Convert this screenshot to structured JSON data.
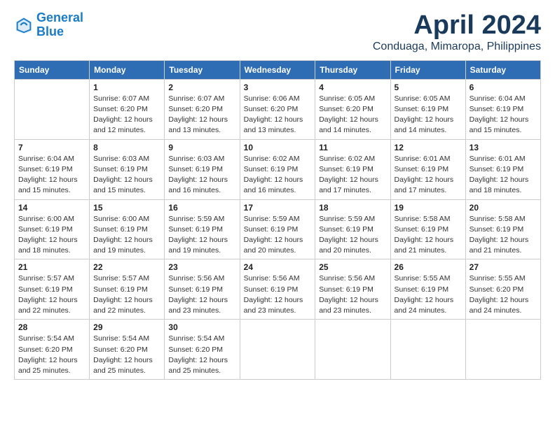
{
  "logo": {
    "line1": "General",
    "line2": "Blue"
  },
  "title": "April 2024",
  "location": "Conduaga, Mimaropa, Philippines",
  "headers": [
    "Sunday",
    "Monday",
    "Tuesday",
    "Wednesday",
    "Thursday",
    "Friday",
    "Saturday"
  ],
  "weeks": [
    [
      {
        "num": "",
        "info": ""
      },
      {
        "num": "1",
        "info": "Sunrise: 6:07 AM\nSunset: 6:20 PM\nDaylight: 12 hours\nand 12 minutes."
      },
      {
        "num": "2",
        "info": "Sunrise: 6:07 AM\nSunset: 6:20 PM\nDaylight: 12 hours\nand 13 minutes."
      },
      {
        "num": "3",
        "info": "Sunrise: 6:06 AM\nSunset: 6:20 PM\nDaylight: 12 hours\nand 13 minutes."
      },
      {
        "num": "4",
        "info": "Sunrise: 6:05 AM\nSunset: 6:20 PM\nDaylight: 12 hours\nand 14 minutes."
      },
      {
        "num": "5",
        "info": "Sunrise: 6:05 AM\nSunset: 6:19 PM\nDaylight: 12 hours\nand 14 minutes."
      },
      {
        "num": "6",
        "info": "Sunrise: 6:04 AM\nSunset: 6:19 PM\nDaylight: 12 hours\nand 15 minutes."
      }
    ],
    [
      {
        "num": "7",
        "info": "Sunrise: 6:04 AM\nSunset: 6:19 PM\nDaylight: 12 hours\nand 15 minutes."
      },
      {
        "num": "8",
        "info": "Sunrise: 6:03 AM\nSunset: 6:19 PM\nDaylight: 12 hours\nand 15 minutes."
      },
      {
        "num": "9",
        "info": "Sunrise: 6:03 AM\nSunset: 6:19 PM\nDaylight: 12 hours\nand 16 minutes."
      },
      {
        "num": "10",
        "info": "Sunrise: 6:02 AM\nSunset: 6:19 PM\nDaylight: 12 hours\nand 16 minutes."
      },
      {
        "num": "11",
        "info": "Sunrise: 6:02 AM\nSunset: 6:19 PM\nDaylight: 12 hours\nand 17 minutes."
      },
      {
        "num": "12",
        "info": "Sunrise: 6:01 AM\nSunset: 6:19 PM\nDaylight: 12 hours\nand 17 minutes."
      },
      {
        "num": "13",
        "info": "Sunrise: 6:01 AM\nSunset: 6:19 PM\nDaylight: 12 hours\nand 18 minutes."
      }
    ],
    [
      {
        "num": "14",
        "info": "Sunrise: 6:00 AM\nSunset: 6:19 PM\nDaylight: 12 hours\nand 18 minutes."
      },
      {
        "num": "15",
        "info": "Sunrise: 6:00 AM\nSunset: 6:19 PM\nDaylight: 12 hours\nand 19 minutes."
      },
      {
        "num": "16",
        "info": "Sunrise: 5:59 AM\nSunset: 6:19 PM\nDaylight: 12 hours\nand 19 minutes."
      },
      {
        "num": "17",
        "info": "Sunrise: 5:59 AM\nSunset: 6:19 PM\nDaylight: 12 hours\nand 20 minutes."
      },
      {
        "num": "18",
        "info": "Sunrise: 5:59 AM\nSunset: 6:19 PM\nDaylight: 12 hours\nand 20 minutes."
      },
      {
        "num": "19",
        "info": "Sunrise: 5:58 AM\nSunset: 6:19 PM\nDaylight: 12 hours\nand 21 minutes."
      },
      {
        "num": "20",
        "info": "Sunrise: 5:58 AM\nSunset: 6:19 PM\nDaylight: 12 hours\nand 21 minutes."
      }
    ],
    [
      {
        "num": "21",
        "info": "Sunrise: 5:57 AM\nSunset: 6:19 PM\nDaylight: 12 hours\nand 22 minutes."
      },
      {
        "num": "22",
        "info": "Sunrise: 5:57 AM\nSunset: 6:19 PM\nDaylight: 12 hours\nand 22 minutes."
      },
      {
        "num": "23",
        "info": "Sunrise: 5:56 AM\nSunset: 6:19 PM\nDaylight: 12 hours\nand 23 minutes."
      },
      {
        "num": "24",
        "info": "Sunrise: 5:56 AM\nSunset: 6:19 PM\nDaylight: 12 hours\nand 23 minutes."
      },
      {
        "num": "25",
        "info": "Sunrise: 5:56 AM\nSunset: 6:19 PM\nDaylight: 12 hours\nand 23 minutes."
      },
      {
        "num": "26",
        "info": "Sunrise: 5:55 AM\nSunset: 6:19 PM\nDaylight: 12 hours\nand 24 minutes."
      },
      {
        "num": "27",
        "info": "Sunrise: 5:55 AM\nSunset: 6:20 PM\nDaylight: 12 hours\nand 24 minutes."
      }
    ],
    [
      {
        "num": "28",
        "info": "Sunrise: 5:54 AM\nSunset: 6:20 PM\nDaylight: 12 hours\nand 25 minutes."
      },
      {
        "num": "29",
        "info": "Sunrise: 5:54 AM\nSunset: 6:20 PM\nDaylight: 12 hours\nand 25 minutes."
      },
      {
        "num": "30",
        "info": "Sunrise: 5:54 AM\nSunset: 6:20 PM\nDaylight: 12 hours\nand 25 minutes."
      },
      {
        "num": "",
        "info": ""
      },
      {
        "num": "",
        "info": ""
      },
      {
        "num": "",
        "info": ""
      },
      {
        "num": "",
        "info": ""
      }
    ]
  ]
}
